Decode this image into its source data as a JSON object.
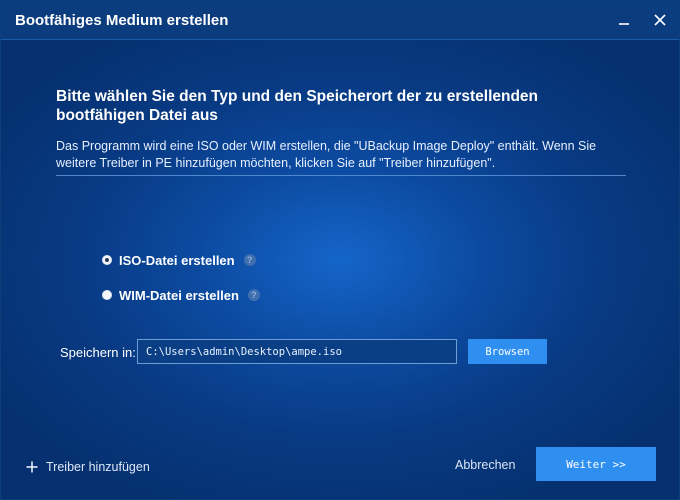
{
  "window": {
    "title": "Bootfähiges Medium erstellen"
  },
  "content": {
    "heading": "Bitte wählen Sie den Typ und den Speicherort der zu erstellenden bootfähigen Datei aus",
    "description": "Das Programm wird eine ISO oder WIM erstellen, die \"UBackup Image Deploy\" enthält. Wenn Sie weitere Treiber in PE hinzufügen möchten, klicken Sie auf \"Treiber hinzufügen\"."
  },
  "options": {
    "iso": {
      "label": "ISO-Datei erstellen",
      "selected": true
    },
    "wim": {
      "label": "WIM-Datei erstellen",
      "selected": false
    },
    "help_glyph": "?"
  },
  "save": {
    "label": "Speichern in:",
    "path": "C:\\Users\\admin\\Desktop\\ampe.iso",
    "browse_label": "Browsen"
  },
  "footer": {
    "add_driver_label": "Treiber hinzufügen",
    "cancel_label": "Abbrechen",
    "next_label": "Weiter >>"
  },
  "icons": {
    "minimize": "minimize-icon",
    "close": "close-icon",
    "help": "help-icon",
    "add": "plus-icon"
  },
  "colors": {
    "titlebar": "#0b3c7e",
    "background": "#0c4aa0",
    "accent_button": "#2f8ff0",
    "divider": "#4f86cc"
  }
}
